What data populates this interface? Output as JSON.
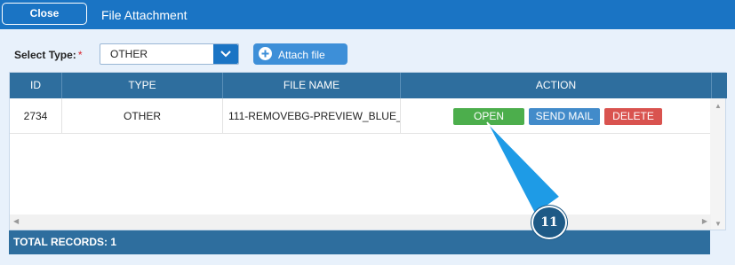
{
  "header": {
    "close_label": "Close",
    "title": "File Attachment"
  },
  "filter": {
    "label": "Select Type:",
    "required_mark": "*",
    "selected_type": "OTHER",
    "attach_label": "Attach file"
  },
  "grid": {
    "columns": [
      "ID",
      "TYPE",
      "FILE NAME",
      "ACTION"
    ],
    "rows": [
      {
        "id": "2734",
        "type": "OTHER",
        "file_name": "111-REMOVEBG-PREVIEW_BLUE_"
      }
    ],
    "actions": {
      "open": "OPEN",
      "send_mail": "SEND MAIL",
      "delete": "DELETE"
    },
    "footer": "TOTAL RECORDS: 1"
  },
  "callout": {
    "number": "11"
  },
  "colors": {
    "header": "#1a74c4",
    "grid_header": "#2e6e9e",
    "open": "#4cae4c",
    "send_mail": "#428bca",
    "delete": "#d9534f",
    "callout": "#1e9be6"
  }
}
